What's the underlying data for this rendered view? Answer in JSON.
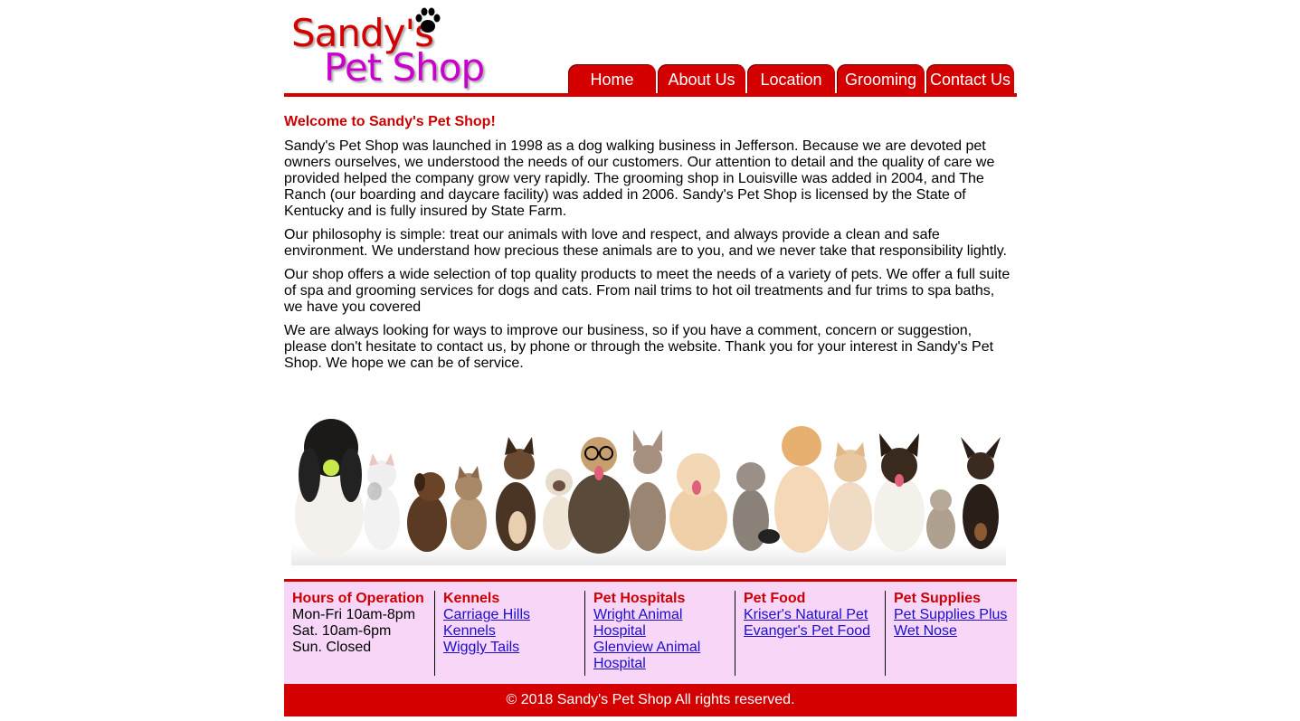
{
  "logo": {
    "line1": "Sandy's",
    "line2": "Pet Shop"
  },
  "nav": [
    "Home",
    "About Us",
    "Location",
    "Grooming",
    "Contact Us"
  ],
  "content": {
    "heading": "Welcome to Sandy's Pet Shop!",
    "paragraphs": [
      "Sandy's Pet Shop was launched in 1998 as a dog walking business in Jefferson. Because we are devoted pet owners ourselves, we understood the needs of our customers. Our attention to detail and the quality of care we provided helped the company grow very rapidly. The grooming shop in Louisville was added in 2004, and The Ranch (our boarding and daycare facility) was added in 2006. Sandy's Pet Shop is licensed by the State of Kentucky and is fully insured by State Farm.",
      "Our philosophy is simple: treat our animals with love and respect, and always provide a clean and safe environment. We understand how precious these animals are to you, and we never take that responsibility lightly.",
      "Our shop offers a wide selection of top quality products to meet the needs of a variety of pets. We offer a full suite of spa and grooming services for dogs and cats. From nail trims to hot oil treatments and fur trims to spa baths, we have you covered",
      "We are always looking for ways to improve our business, so if you have a comment, concern or suggestion, please don't hesitate to contact us, by phone or through the website. Thank you for your interest in Sandy's Pet Shop. We hope we can be of service."
    ]
  },
  "footer": {
    "hours": {
      "title": "Hours of Operation",
      "lines": [
        "Mon-Fri 10am-8pm",
        "Sat. 10am-6pm",
        "Sun. Closed"
      ]
    },
    "kennels": {
      "title": "Kennels",
      "links": [
        "Carriage Hills Kennels",
        "Wiggly Tails"
      ]
    },
    "hospitals": {
      "title": "Pet Hospitals",
      "links": [
        "Wright Animal Hospital",
        "Glenview Animal Hospital"
      ]
    },
    "food": {
      "title": "Pet Food",
      "links": [
        "Kriser's Natural Pet",
        "Evanger's Pet Food"
      ]
    },
    "supplies": {
      "title": "Pet Supplies",
      "links": [
        "Pet Supplies Plus",
        "Wet Nose"
      ]
    }
  },
  "copyright": "© 2018 Sandy's Pet Shop All rights reserved.",
  "colors": {
    "brand_red": "#d40000",
    "logo_magenta": "#cc00cc",
    "footer_bg": "#f7d6f7",
    "link": "#1a0dcc"
  }
}
